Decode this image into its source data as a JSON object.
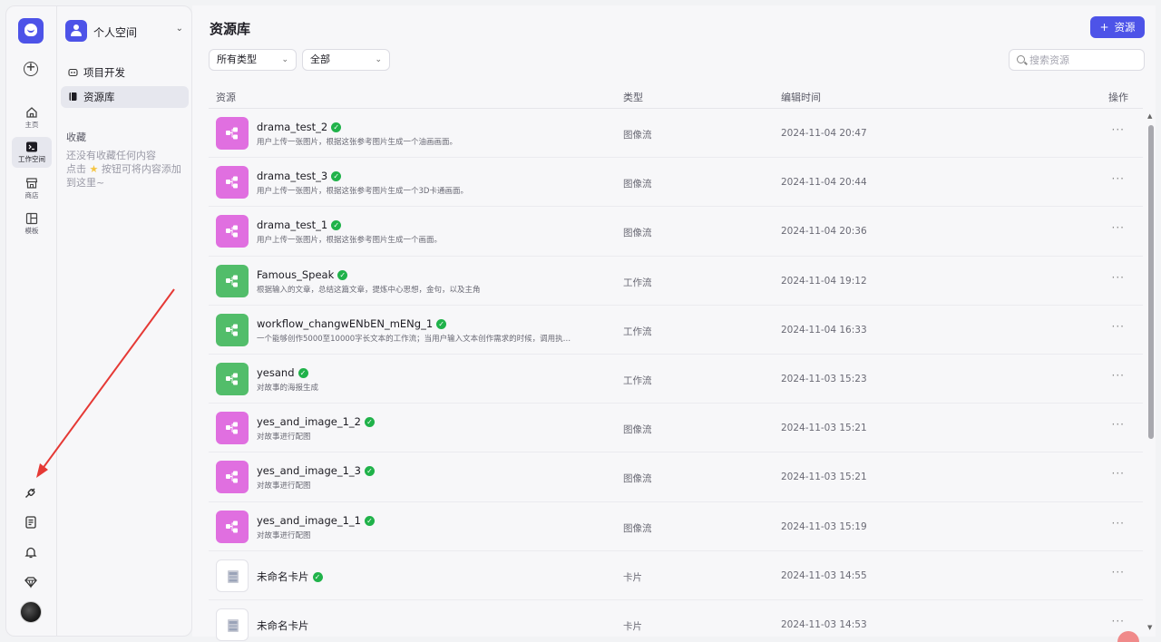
{
  "rail": {
    "items": [
      {
        "label": "主页",
        "icon": "home-icon"
      },
      {
        "label": "工作空间",
        "icon": "terminal-icon"
      },
      {
        "label": "商店",
        "icon": "store-icon"
      },
      {
        "label": "模板",
        "icon": "template-icon"
      }
    ],
    "bottom_icons": [
      "plugin-icon",
      "document-icon",
      "bell-icon",
      "diamond-icon"
    ]
  },
  "sidebar": {
    "space_name": "个人空间",
    "nav": [
      {
        "label": "项目开发",
        "icon": "bot-icon"
      },
      {
        "label": "资源库",
        "icon": "library-icon"
      }
    ],
    "favorites_title": "收藏",
    "favorites_empty_1": "还没有收藏任何内容",
    "favorites_empty_2a": "点击",
    "favorites_empty_2b": "按钮可将内容添加到这里~"
  },
  "main": {
    "title": "资源库",
    "add_button": "资源",
    "filter_type": "所有类型",
    "filter_scope": "全部",
    "search_placeholder": "搜索资源",
    "columns": {
      "resource": "资源",
      "type": "类型",
      "time": "编辑时间",
      "actions": "操作"
    }
  },
  "rows": [
    {
      "name": "drama_test_2",
      "desc": "用户上传一张图片，根据这张参考图片生成一个油画画面。",
      "type": "图像流",
      "time": "2024-11-04 20:47",
      "kind": "img",
      "verified": true
    },
    {
      "name": "drama_test_3",
      "desc": "用户上传一张图片，根据这张参考图片生成一个3D卡通画面。",
      "type": "图像流",
      "time": "2024-11-04 20:44",
      "kind": "img",
      "verified": true
    },
    {
      "name": "drama_test_1",
      "desc": "用户上传一张图片，根据这张参考图片生成一个画面。",
      "type": "图像流",
      "time": "2024-11-04 20:36",
      "kind": "img",
      "verified": true
    },
    {
      "name": "Famous_Speak",
      "desc": "根据输入的文章，总结这篇文章，提炼中心思想，金句，以及主角",
      "type": "工作流",
      "time": "2024-11-04 19:12",
      "kind": "wf",
      "verified": true
    },
    {
      "name": "workflow_changwENbEN_mENg_1",
      "desc": "一个能够创作5000至10000字长文本的工作流；当用户输入文本创作需求的时候，调用执…",
      "type": "工作流",
      "time": "2024-11-04 16:33",
      "kind": "wf",
      "verified": true
    },
    {
      "name": "yesand",
      "desc": "对故事的海报生成",
      "type": "工作流",
      "time": "2024-11-03 15:23",
      "kind": "wf",
      "verified": true
    },
    {
      "name": "yes_and_image_1_2",
      "desc": "对故事进行配图",
      "type": "图像流",
      "time": "2024-11-03 15:21",
      "kind": "img",
      "verified": true
    },
    {
      "name": "yes_and_image_1_3",
      "desc": "对故事进行配图",
      "type": "图像流",
      "time": "2024-11-03 15:21",
      "kind": "img",
      "verified": true
    },
    {
      "name": "yes_and_image_1_1",
      "desc": "对故事进行配图",
      "type": "图像流",
      "time": "2024-11-03 15:19",
      "kind": "img",
      "verified": true
    },
    {
      "name": "未命名卡片",
      "desc": "",
      "type": "卡片",
      "time": "2024-11-03 14:55",
      "kind": "card",
      "verified": true
    },
    {
      "name": "未命名卡片",
      "desc": "",
      "type": "卡片",
      "time": "2024-11-03 14:53",
      "kind": "card",
      "verified": false
    }
  ],
  "colors": {
    "accent": "#4d53e8",
    "imageflow": "#e06fe0",
    "workflow": "#52bd6a",
    "verified": "#20b24a",
    "annotation_arrow": "#e53935"
  }
}
